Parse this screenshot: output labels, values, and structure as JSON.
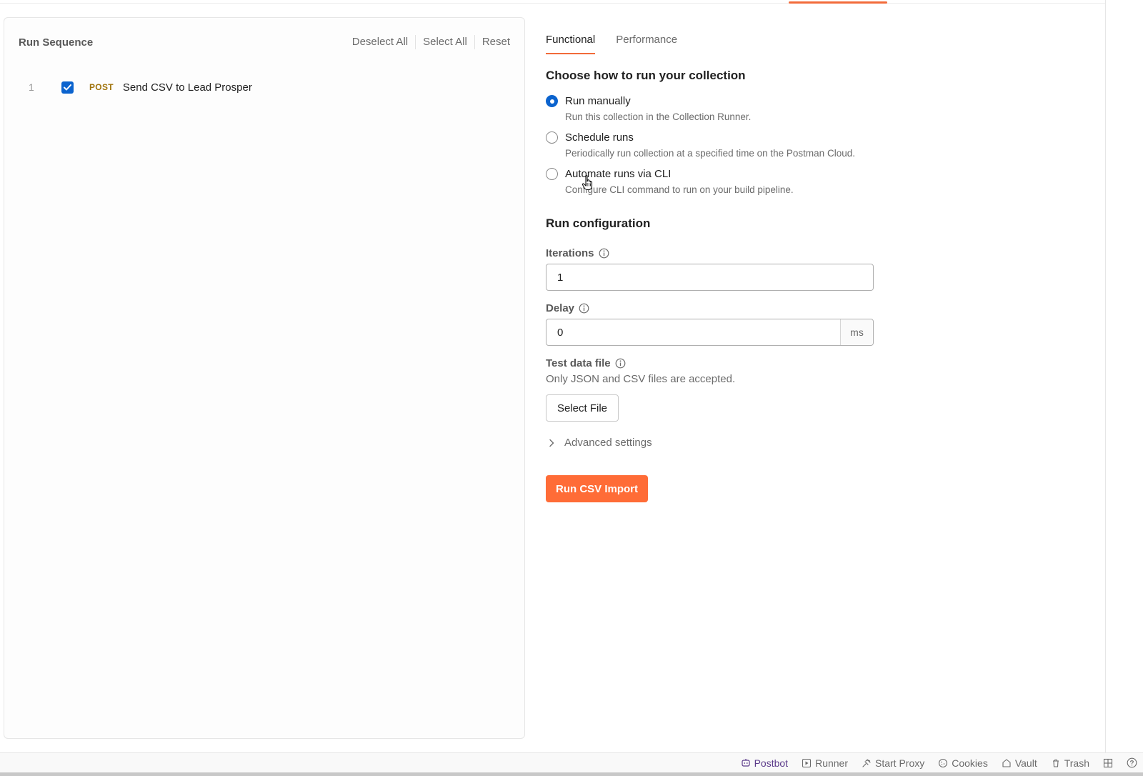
{
  "run_sequence": {
    "title": "Run Sequence",
    "actions": [
      "Deselect All",
      "Select All",
      "Reset"
    ],
    "items": [
      {
        "index": "1",
        "method": "POST",
        "name": "Send CSV to Lead Prosper",
        "checked": true
      }
    ]
  },
  "tabs": [
    {
      "label": "Functional",
      "active": true
    },
    {
      "label": "Performance",
      "active": false
    }
  ],
  "run_mode": {
    "title": "Choose how to run your collection",
    "options": [
      {
        "label": "Run manually",
        "desc": "Run this collection in the Collection Runner.",
        "selected": true
      },
      {
        "label": "Schedule runs",
        "desc": "Periodically run collection at a specified time on the Postman Cloud.",
        "selected": false
      },
      {
        "label": "Automate runs via CLI",
        "desc": "Configure CLI command to run on your build pipeline.",
        "selected": false
      }
    ]
  },
  "run_config": {
    "title": "Run configuration",
    "iterations_label": "Iterations",
    "iterations_value": "1",
    "delay_label": "Delay",
    "delay_value": "0",
    "delay_unit": "ms",
    "test_data_label": "Test data file",
    "test_data_helper": "Only JSON and CSV files are accepted.",
    "select_file_label": "Select File",
    "advanced_label": "Advanced settings",
    "run_button_label": "Run CSV Import"
  },
  "status_bar": {
    "items": [
      "Postbot",
      "Runner",
      "Start Proxy",
      "Cookies",
      "Vault",
      "Trash"
    ]
  },
  "colors": {
    "accent": "#ff6c37",
    "primary_blue": "#0b63ce",
    "post_method": "#a0730b"
  }
}
